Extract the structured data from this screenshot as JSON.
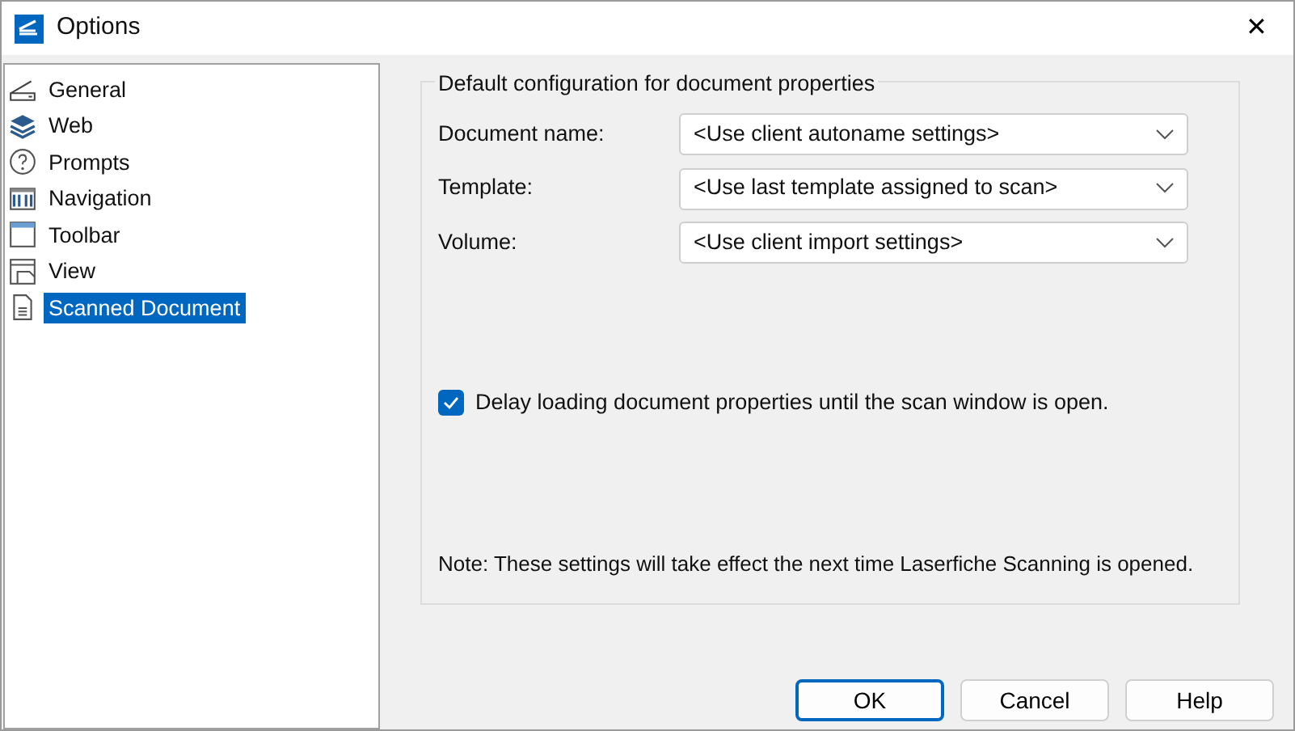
{
  "window": {
    "title": "Options",
    "close": "✕"
  },
  "sidebar": {
    "items": [
      {
        "label": "General",
        "kind": "scanner",
        "selected": false
      },
      {
        "label": "Web",
        "kind": "layers",
        "selected": false
      },
      {
        "label": "Prompts",
        "kind": "question",
        "selected": false
      },
      {
        "label": "Navigation",
        "kind": "navigation",
        "selected": false
      },
      {
        "label": "Toolbar",
        "kind": "toolbar",
        "selected": false
      },
      {
        "label": "View",
        "kind": "view",
        "selected": false
      },
      {
        "label": "Scanned Document",
        "kind": "document",
        "selected": true
      }
    ]
  },
  "group": {
    "title": "Default configuration for document properties",
    "fields": [
      {
        "label": "Document name:",
        "value": "<Use client autoname settings>"
      },
      {
        "label": "Template:",
        "value": "<Use last template assigned to scan>"
      },
      {
        "label": "Volume:",
        "value": "<Use client import settings>"
      }
    ],
    "checkbox": {
      "label": "Delay loading document properties until the scan window is open.",
      "checked": true
    },
    "note": "Note: These settings will take effect the next time Laserfiche Scanning is opened."
  },
  "buttons": [
    {
      "label": "OK",
      "default": true
    },
    {
      "label": "Cancel",
      "default": false
    },
    {
      "label": "Help",
      "default": false
    }
  ]
}
